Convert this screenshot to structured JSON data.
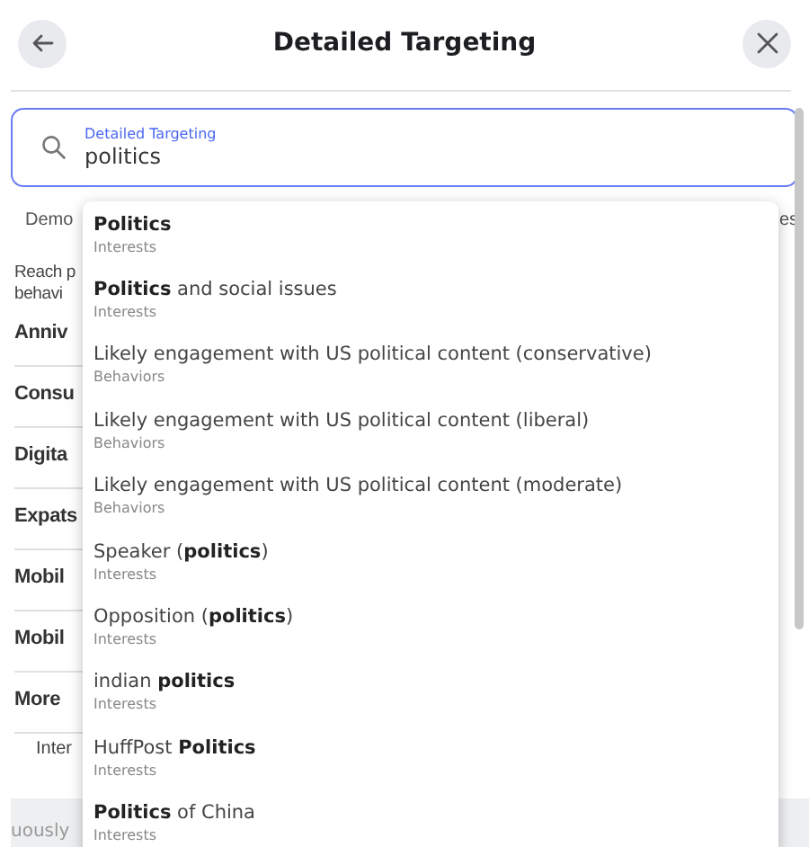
{
  "header": {
    "title": "Detailed Targeting"
  },
  "search": {
    "label": "Detailed Targeting",
    "value": "politics"
  },
  "background": {
    "tabs": [
      "Demo",
      "es"
    ],
    "description": [
      "Reach p",
      "behavi"
    ],
    "categories": [
      "Anniv",
      "Consu",
      "Digita",
      "Expats",
      "Mobil",
      "Mobil",
      "More"
    ],
    "subcategory": "Inter",
    "footer": "uously"
  },
  "suggestions": [
    {
      "name": "**Politics**",
      "type": "Interests"
    },
    {
      "name": "**Politics** and social issues",
      "type": "Interests"
    },
    {
      "name": "Likely engagement with US political content (conservative)",
      "type": "Behaviors"
    },
    {
      "name": "Likely engagement with US political content (liberal)",
      "type": "Behaviors"
    },
    {
      "name": "Likely engagement with US political content (moderate)",
      "type": "Behaviors"
    },
    {
      "name": "Speaker (**politics**)",
      "type": "Interests"
    },
    {
      "name": "Opposition (**politics**)",
      "type": "Interests"
    },
    {
      "name": "indian **politics**",
      "type": "Interests"
    },
    {
      "name": "HuffPost **Politics**",
      "type": "Interests"
    },
    {
      "name": "**Politics** of China",
      "type": "Interests"
    }
  ]
}
